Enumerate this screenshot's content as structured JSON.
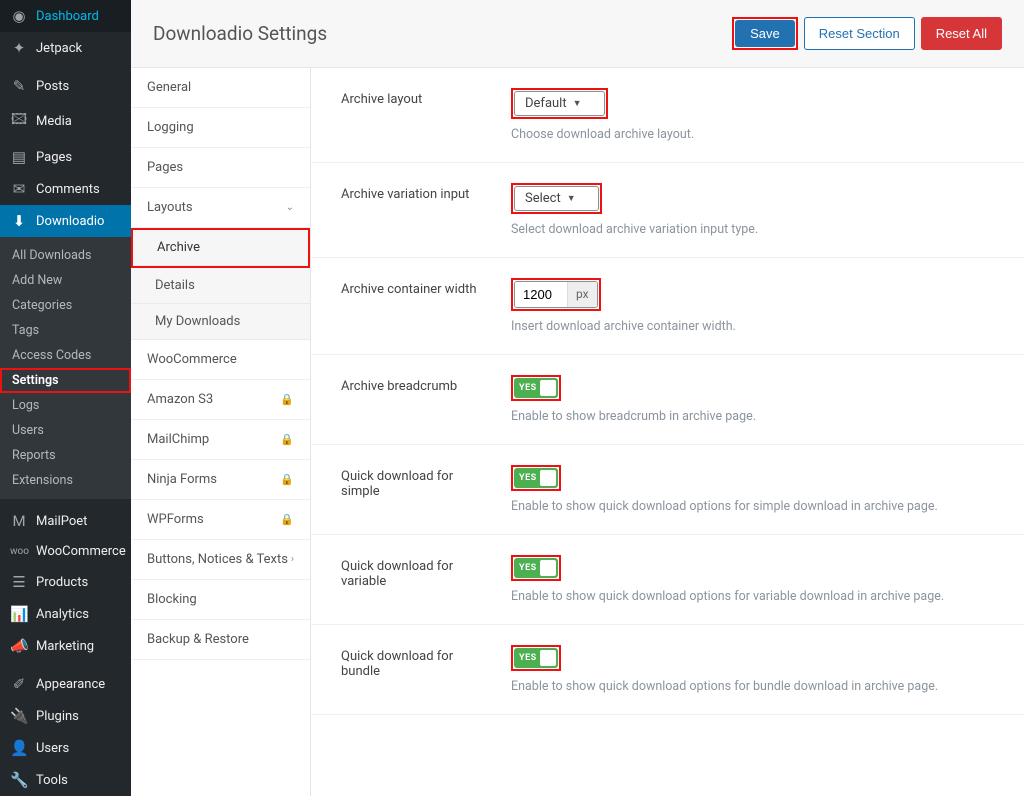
{
  "wp_menu": {
    "dashboard": "Dashboard",
    "jetpack": "Jetpack",
    "posts": "Posts",
    "media": "Media",
    "pages": "Pages",
    "comments": "Comments",
    "downloadio": "Downloadio",
    "downloadio_sub": {
      "all": "All Downloads",
      "add": "Add New",
      "categories": "Categories",
      "tags": "Tags",
      "access": "Access Codes",
      "settings": "Settings",
      "logs": "Logs",
      "users": "Users",
      "reports": "Reports",
      "extensions": "Extensions"
    },
    "mailpoet": "MailPoet",
    "woocommerce": "WooCommerce",
    "products": "Products",
    "analytics": "Analytics",
    "marketing": "Marketing",
    "appearance": "Appearance",
    "plugins": "Plugins",
    "users": "Users",
    "tools": "Tools"
  },
  "header": {
    "title": "Downloadio Settings",
    "save": "Save",
    "reset_section": "Reset Section",
    "reset_all": "Reset All"
  },
  "settings_nav": {
    "general": "General",
    "logging": "Logging",
    "pages": "Pages",
    "layouts": "Layouts",
    "layouts_sub": {
      "archive": "Archive",
      "details": "Details",
      "my_downloads": "My Downloads"
    },
    "woocommerce": "WooCommerce",
    "amazon_s3": "Amazon S3",
    "mailchimp": "MailChimp",
    "ninja_forms": "Ninja Forms",
    "wpforms": "WPForms",
    "buttons_notices": "Buttons, Notices & Texts",
    "blocking": "Blocking",
    "backup": "Backup & Restore"
  },
  "fields": {
    "archive_layout": {
      "label": "Archive layout",
      "value": "Default",
      "help": "Choose download archive layout."
    },
    "archive_variation": {
      "label": "Archive variation input",
      "value": "Select",
      "help": "Select download archive variation input type."
    },
    "container_width": {
      "label": "Archive container width",
      "value": "1200",
      "unit": "px",
      "help": "Insert download archive container width."
    },
    "breadcrumb": {
      "label": "Archive breadcrumb",
      "value": "YES",
      "help": "Enable to show breadcrumb in archive page."
    },
    "quick_simple": {
      "label": "Quick download for simple",
      "value": "YES",
      "help": "Enable to show quick download options for simple download in archive page."
    },
    "quick_variable": {
      "label": "Quick download for variable",
      "value": "YES",
      "help": "Enable to show quick download options for variable download in archive page."
    },
    "quick_bundle": {
      "label": "Quick download for bundle",
      "value": "YES",
      "help": "Enable to show quick download options for bundle download in archive page."
    }
  }
}
